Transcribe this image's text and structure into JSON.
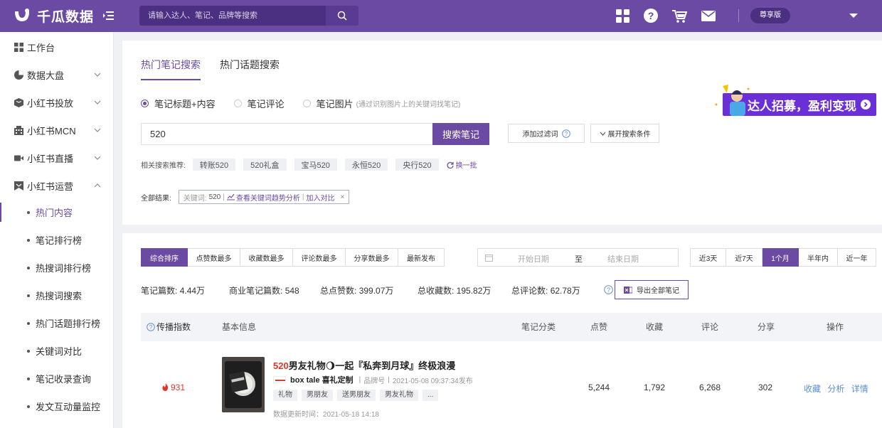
{
  "header": {
    "logo_text": "千瓜数据",
    "search_placeholder": "请输入达人、笔记、品牌等搜索",
    "vip_label": "尊享版"
  },
  "sidebar": {
    "items": [
      {
        "label": "工作台"
      },
      {
        "label": "数据大盘"
      },
      {
        "label": "小红书投放"
      },
      {
        "label": "小红书MCN"
      },
      {
        "label": "小红书直播"
      },
      {
        "label": "小红书运营"
      }
    ],
    "sub_items": [
      {
        "label": "热门内容"
      },
      {
        "label": "笔记排行榜"
      },
      {
        "label": "热搜词排行榜"
      },
      {
        "label": "热搜词搜索"
      },
      {
        "label": "热门话题排行榜"
      },
      {
        "label": "关键词对比"
      },
      {
        "label": "笔记收录查询"
      },
      {
        "label": "发文互动量监控"
      }
    ]
  },
  "search_card": {
    "tabs": [
      "热门笔记搜索",
      "热门话题搜索"
    ],
    "radios": [
      {
        "label": "笔记标题+内容"
      },
      {
        "label": "笔记评论"
      },
      {
        "label": "笔记图片",
        "hint": "(通过识别图片上的关键词找笔记)"
      }
    ],
    "keyword": "520",
    "search_btn": "搜索笔记",
    "filter_btn": "添加过滤词",
    "expand_btn": "展开搜索条件",
    "related_label": "相关搜索推荐:",
    "related": [
      "转账520",
      "520礼盒",
      "宝马520",
      "永恒520",
      "央行520"
    ],
    "refresh": "换一批",
    "result_label": "全部结果:",
    "result_kw_label": "关键词:",
    "result_kw": "520",
    "trend_link": "查看关键词趋势分析",
    "compare_link": "加入对比",
    "close": "×",
    "promo_text": "达人招募，盈利变现"
  },
  "list_card": {
    "sort_tabs": [
      "综合排序",
      "点赞数最多",
      "收藏数最多",
      "评论数最多",
      "分享数最多",
      "最新发布"
    ],
    "date_start": "开始日期",
    "date_sep": "至",
    "date_end": "结束日期",
    "range_tabs": [
      "近3天",
      "近7天",
      "1个月",
      "半年内",
      "近一年"
    ],
    "stats": [
      {
        "label": "笔记篇数:",
        "value": "4.44万"
      },
      {
        "label": "商业笔记篇数:",
        "value": "548"
      },
      {
        "label": "总点赞数:",
        "value": "399.07万"
      },
      {
        "label": "总收藏数:",
        "value": "195.82万"
      },
      {
        "label": "总评论数:",
        "value": "62.78万"
      }
    ],
    "export_btn": "导出全部笔记",
    "columns": [
      "传播指数",
      "基本信息",
      "笔记分类",
      "点赞",
      "收藏",
      "评论",
      "分享",
      "操作"
    ],
    "rows": [
      {
        "index": "931",
        "title_hl": "520",
        "title": "男友礼物🌖一起『私奔到月球』终极浪漫",
        "brand": "box tale 喜礼定制",
        "brand_tag": "品牌号",
        "published": "2021-05-08 09:37:34发布",
        "tags": [
          "礼物",
          "男朋友",
          "送男朋友",
          "男友礼物",
          "..."
        ],
        "updated": "数据更新时间：2021-05-18 14:18",
        "likes": "5,244",
        "favorites": "1,792",
        "comments": "6,268",
        "shares": "302",
        "ops": [
          "收藏",
          "分析",
          "详情"
        ]
      }
    ]
  },
  "colors": {
    "brand": "#6a4aa2",
    "link": "#5b8fd8",
    "hot": "#e0352b"
  }
}
